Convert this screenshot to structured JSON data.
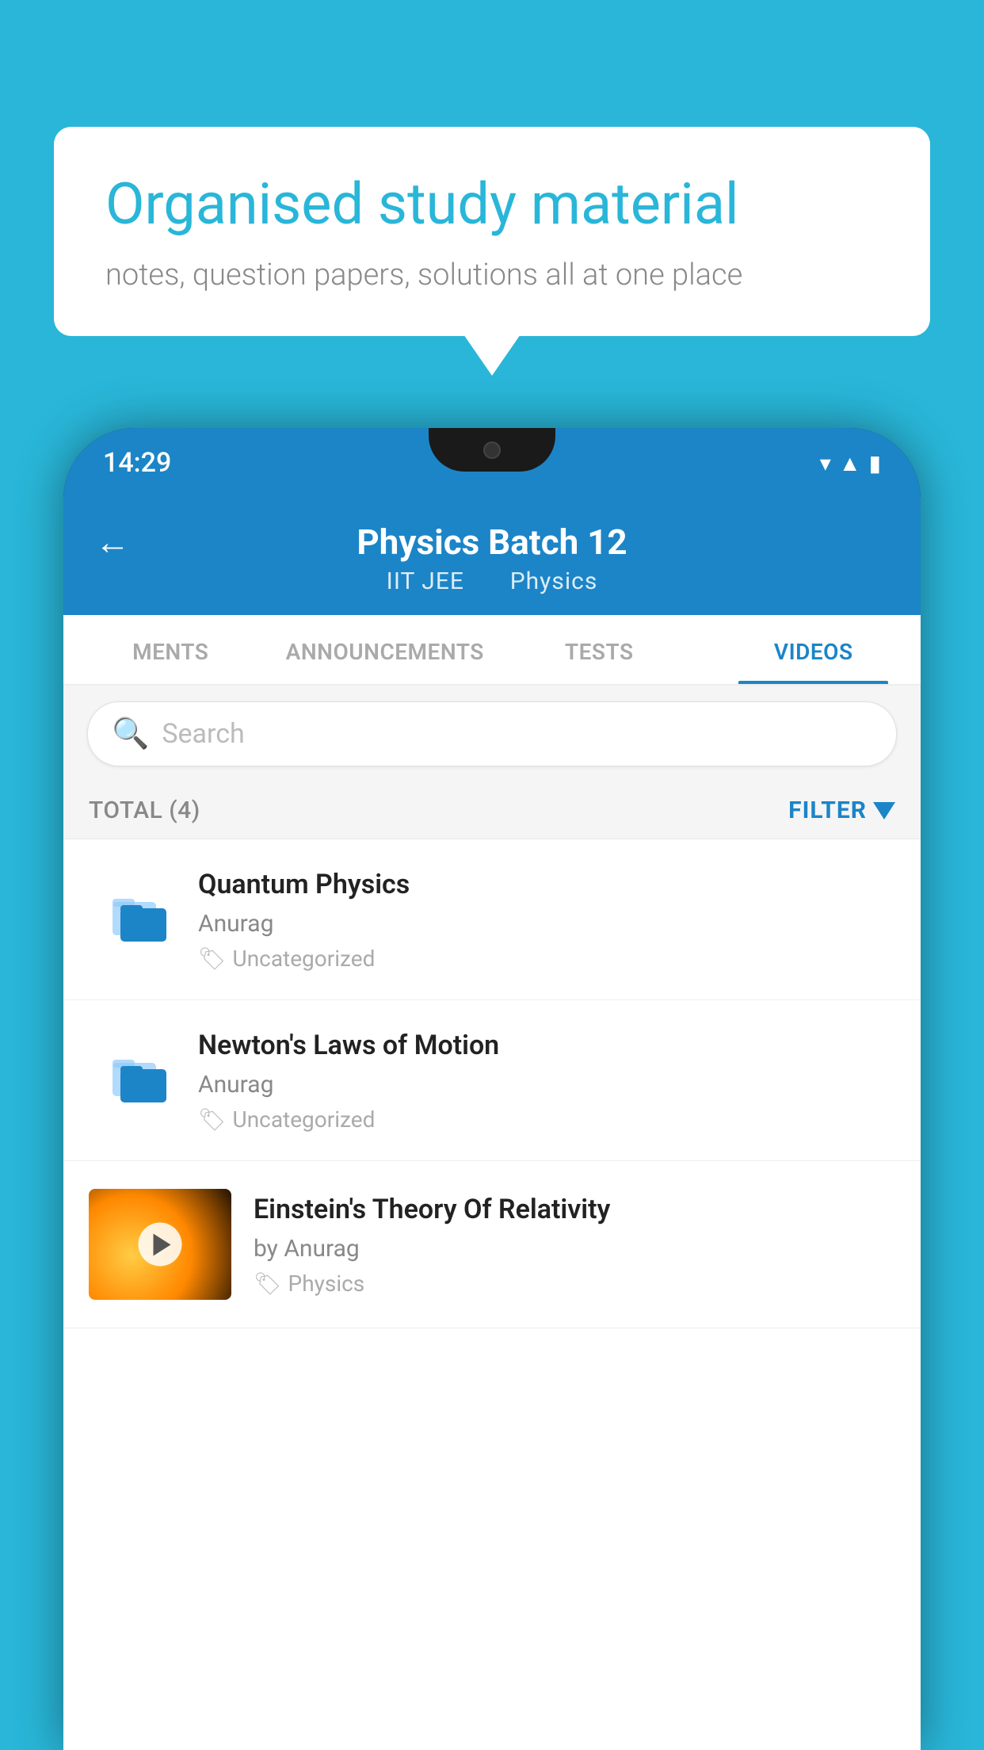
{
  "background_color": "#29b6d8",
  "speech_bubble": {
    "heading": "Organised study material",
    "subtext": "notes, question papers, solutions all at one place"
  },
  "phone": {
    "status_bar": {
      "time": "14:29"
    },
    "header": {
      "back_label": "←",
      "title": "Physics Batch 12",
      "subtitle_part1": "IIT JEE",
      "subtitle_part2": "Physics"
    },
    "tabs": [
      {
        "label": "MENTS",
        "active": false
      },
      {
        "label": "ANNOUNCEMENTS",
        "active": false
      },
      {
        "label": "TESTS",
        "active": false
      },
      {
        "label": "VIDEOS",
        "active": true
      }
    ],
    "search": {
      "placeholder": "Search"
    },
    "total_label": "TOTAL (4)",
    "filter_label": "FILTER",
    "videos": [
      {
        "type": "folder",
        "title": "Quantum Physics",
        "author": "Anurag",
        "tag": "Uncategorized"
      },
      {
        "type": "folder",
        "title": "Newton's Laws of Motion",
        "author": "Anurag",
        "tag": "Uncategorized"
      },
      {
        "type": "video",
        "title": "Einstein's Theory Of Relativity",
        "author": "by Anurag",
        "tag": "Physics"
      }
    ]
  }
}
